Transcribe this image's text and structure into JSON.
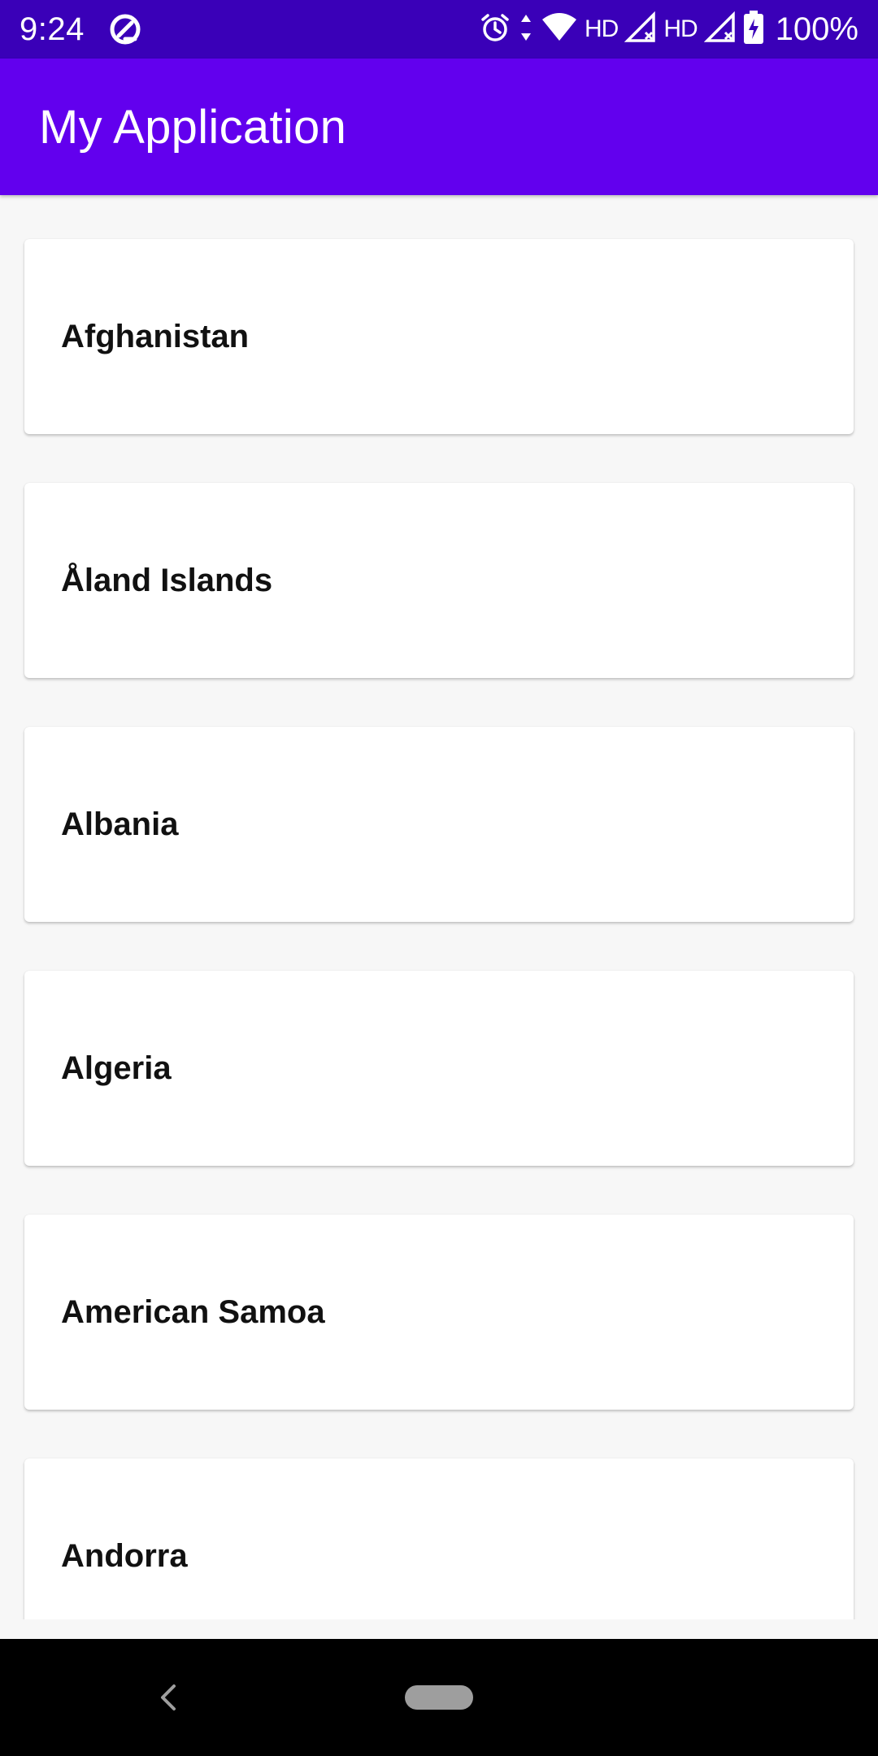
{
  "status_bar": {
    "time": "9:24",
    "hd_label_1": "HD",
    "hd_label_2": "HD",
    "battery": "100%",
    "icons": [
      "data-saver-icon",
      "alarm-icon",
      "data-arrows-icon",
      "wifi-icon",
      "signal-icon",
      "signal-icon",
      "battery-charging-icon"
    ]
  },
  "app_bar": {
    "title": "My Application"
  },
  "list": {
    "items": [
      {
        "label": "Afghanistan"
      },
      {
        "label": "Åland Islands"
      },
      {
        "label": "Albania"
      },
      {
        "label": "Algeria"
      },
      {
        "label": "American Samoa"
      },
      {
        "label": "Andorra"
      }
    ]
  },
  "nav_bar": {
    "icons": [
      "back-icon",
      "home-pill-icon"
    ]
  },
  "colors": {
    "status_bar": "#3a00b8",
    "app_bar": "#6200ee",
    "background": "#f7f7f7",
    "card": "#ffffff"
  }
}
